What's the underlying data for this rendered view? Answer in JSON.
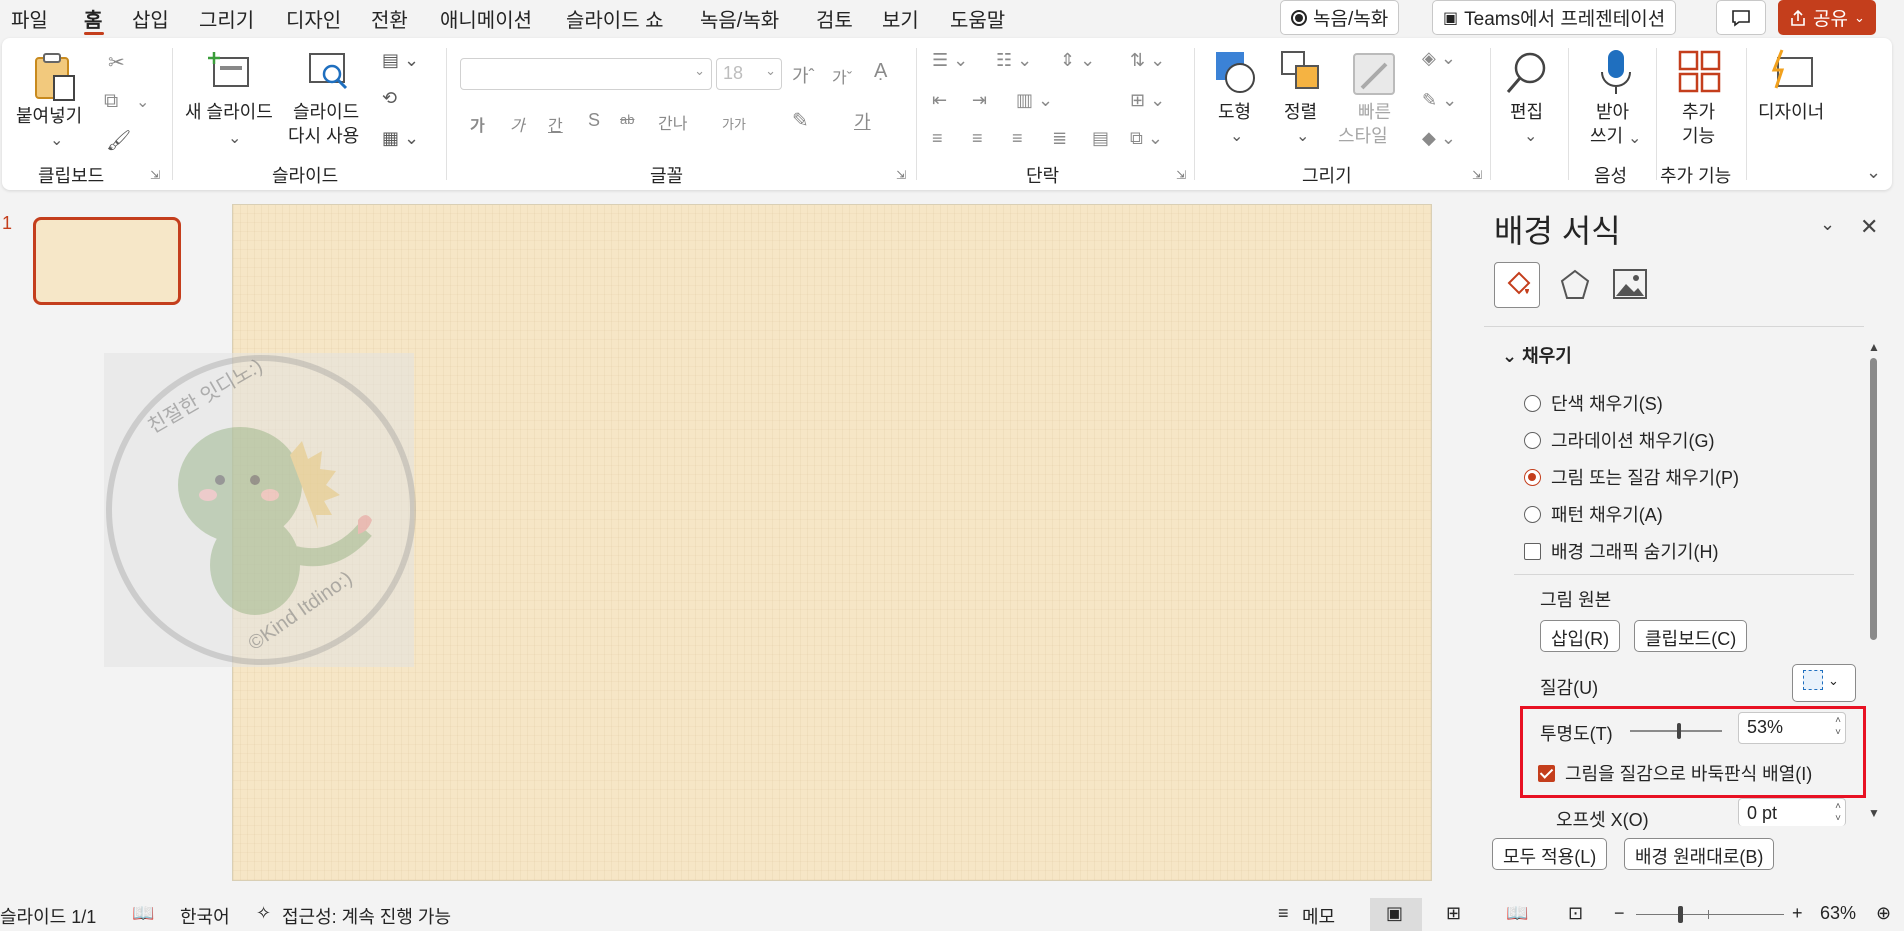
{
  "menu": {
    "tabs": [
      "파일",
      "홈",
      "삽입",
      "그리기",
      "디자인",
      "전환",
      "애니메이션",
      "슬라이드 쇼",
      "녹음/녹화",
      "검토",
      "보기",
      "도움말"
    ],
    "active_tab": "홈",
    "record_label": "녹음/녹화",
    "teams_label": "Teams에서 프레젠테이션",
    "share_label": "공유",
    "accent": "#c43e1c"
  },
  "ribbon": {
    "clipboard": {
      "paste_label": "붙여넣기",
      "group_label": "클립보드"
    },
    "slides": {
      "new_slide_label": "새 슬라이드",
      "reuse_label_1": "슬라이드",
      "reuse_label_2": "다시 사용",
      "group_label": "슬라이드"
    },
    "font": {
      "font_size_value": "18",
      "buttons": [
        "가",
        "가",
        "간",
        "S",
        "ab",
        "간나",
        "가가"
      ],
      "grow_label": "가ˆ",
      "shrink_label": "가ˇ",
      "group_label": "글꼴"
    },
    "paragraph": {
      "group_label": "단락"
    },
    "drawing": {
      "shapes_label": "도형",
      "arrange_label": "정렬",
      "quick_styles_label_1": "빠른",
      "quick_styles_label_2": "스타일",
      "group_label": "그리기"
    },
    "editing": {
      "edit_label": "편집"
    },
    "voice": {
      "dictate_label_1": "받아",
      "dictate_label_2": "쓰기",
      "group_label": "음성"
    },
    "addins": {
      "label_1": "추가",
      "label_2": "기능",
      "group_label": "추가 기능"
    },
    "designer": {
      "label": "디자이너"
    }
  },
  "thumbnails": {
    "slide_number": "1"
  },
  "pane": {
    "title": "배경 서식",
    "section_fill": "채우기",
    "options": [
      {
        "label": "단색 채우기(S)",
        "selected": false
      },
      {
        "label": "그라데이션 채우기(G)",
        "selected": false
      },
      {
        "label": "그림 또는 질감 채우기(P)",
        "selected": true
      },
      {
        "label": "패턴 채우기(A)",
        "selected": false
      }
    ],
    "hide_graphics_label": "배경 그래픽 숨기기(H)",
    "picture_source_label": "그림 원본",
    "insert_label": "삽입(R)",
    "clipboard_label": "클립보드(C)",
    "texture_label": "질감(U)",
    "transparency_label": "투명도(T)",
    "transparency_value": "53%",
    "transparency_level": 0.53,
    "tile_label": "그림을 질감으로 바둑판식 배열(I)",
    "tile_checked": true,
    "offset_x_label": "오프셋 X(O)",
    "offset_x_value": "0 pt",
    "apply_all_label": "모두 적용(L)",
    "reset_label": "배경 원래대로(B)",
    "highlight_color": "#e81123"
  },
  "watermark": {
    "top_text": "친절한 잇디노:)",
    "bottom_text": "©Kind Itdino:)"
  },
  "status": {
    "slide_info": "슬라이드 1/1",
    "language": "한국어",
    "accessibility": "접근성: 계속 진행 가능",
    "notes_label": "메모",
    "zoom_value": "63%",
    "zoom_level": 0.63,
    "minus": "−",
    "plus": "+"
  }
}
